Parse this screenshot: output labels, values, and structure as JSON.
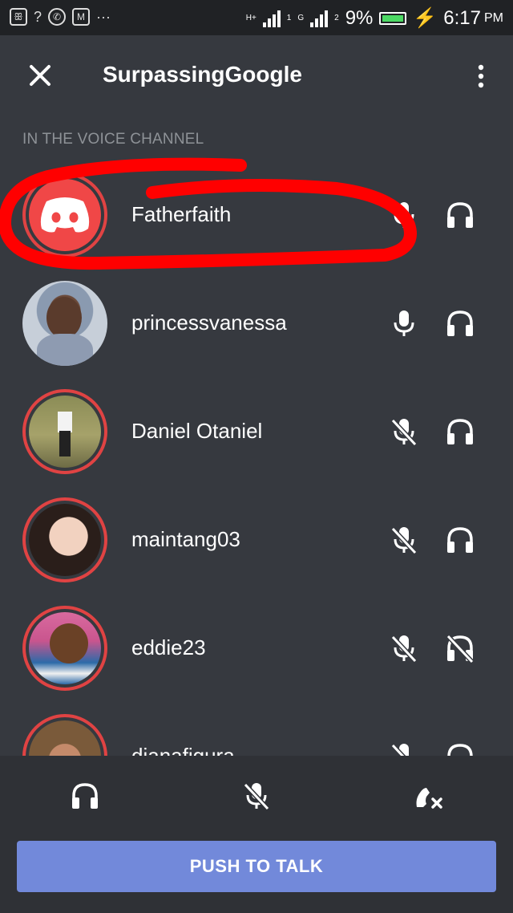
{
  "status_bar": {
    "battery": "9%",
    "time": "6:17",
    "ampm": "PM",
    "network_1": "H+",
    "network_2": "G",
    "sim_1": "1",
    "sim_2": "2",
    "more": "···"
  },
  "header": {
    "title": "SurpassingGoogle"
  },
  "section_label": "IN THE VOICE CHANNEL",
  "users": [
    {
      "name": "Fatherfaith",
      "avatar": "discord-logo",
      "mic": "on",
      "headphones": "on"
    },
    {
      "name": "princessvanessa",
      "avatar": "photo",
      "mic": "on",
      "headphones": "on"
    },
    {
      "name": "Daniel Otaniel",
      "avatar": "photo",
      "mic": "muted",
      "headphones": "on"
    },
    {
      "name": "maintang03",
      "avatar": "photo",
      "mic": "muted",
      "headphones": "on"
    },
    {
      "name": "eddie23",
      "avatar": "photo",
      "mic": "muted",
      "headphones": "deafened"
    },
    {
      "name": "dianafigura",
      "avatar": "photo",
      "mic": "muted",
      "headphones": "on"
    }
  ],
  "bottom": {
    "push_to_talk": "PUSH TO TALK"
  },
  "colors": {
    "background": "#36393f",
    "bottom_bar": "#2f3136",
    "accent": "#7289da",
    "speaking_ring": "#e04343",
    "annotation": "#ff0000"
  }
}
